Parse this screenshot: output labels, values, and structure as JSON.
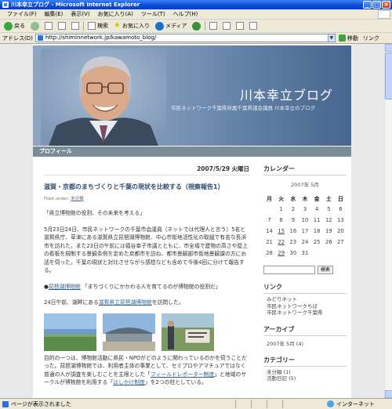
{
  "window": {
    "title": "川本幸立ブログ - Microsoft Internet Explorer"
  },
  "menu": [
    "ファイル(F)",
    "編集(E)",
    "表示(V)",
    "お気に入り(A)",
    "ツール(T)",
    "ヘルプ(H)"
  ],
  "toolbar": {
    "back": "戻る",
    "search": "検索",
    "favorites": "お気に入り",
    "media": "メディア"
  },
  "address": {
    "label": "アドレス(D)",
    "url": "http://shiminnetwork.jp/kawamoto_blog/",
    "go": "移動",
    "links": "リンク"
  },
  "blog": {
    "title": "川本幸立ブログ",
    "subtitle": "市民ネットワーク千葉県所属千葉県議会議員  川本幸立のブログ",
    "nav_profile": "プロフィール"
  },
  "post": {
    "date": "2007/5/29",
    "weekday": "火曜日",
    "title": "滋賀・京都のまちづくりと千葉の現状を比較する（視察報告1）",
    "filed_label": "Filed under:",
    "filed_category": "未分類",
    "para1": "「県立博物館の役割、その未来を考える」",
    "para2": "5月23日24日、市民ネットワークの千葉市会議員（ネットでは代理人と言う）5名と滋賀県庁、草津にある滋賀県立琵琶湖博物館、中心市街地活性化の取組で有名な長浜市を訪れた。また23日の午前には福谷幸子市議とともに、市全域で建物の高さや屋上の看板を規制する景観条例を定めた京都市を訪ね、都市景観部市街地景観課の方にお話を伺った。千葉の現状と対比させながら感想なども含めて今後4回に分けて報告する。",
    "para3_prefix": "●",
    "para3_link": "琵琶湖博物館",
    "para3_suffix": "  「まちづくりにかかわる人を育てるのが博物館の役割だ」",
    "para4_prefix": "24日午前、湖畔にある",
    "para4_link": "滋賀県立琵琶湖博物館",
    "para4_suffix": "を訪問した。",
    "para5_a": "目的の一つは、博物館活動に県民・NPOがどのように関わっているのかを伺うことだった。琵琶湖博物館では、利用者主体の事業として、セミプロやアマチュアではなく普通の人が調査を楽しむことを主眼とした「",
    "para5_link1": "フィールドレポーター制度",
    "para5_b": "」と地域のサークルが博物館を利用する「",
    "para5_link2": "はしかけ制度",
    "para5_c": "」を2つの柱としている。"
  },
  "sidebar": {
    "calendar_heading": "カレンダー",
    "month": "2007年 5月",
    "weekdays": [
      "月",
      "火",
      "水",
      "木",
      "金",
      "土",
      "日"
    ],
    "weeks": [
      [
        "",
        "1",
        "2",
        "3",
        "4",
        "5",
        "6"
      ],
      [
        "7",
        "8",
        "9",
        "10",
        "11",
        "12",
        "13"
      ],
      [
        "14",
        "15",
        "16",
        "17",
        "18",
        "19",
        "20"
      ],
      [
        "21",
        "22",
        "23",
        "24",
        "25",
        "26",
        "27"
      ],
      [
        "28",
        "29",
        "30",
        "31",
        "",
        "",
        ""
      ]
    ],
    "linked_days": [
      "15",
      "22",
      "29"
    ],
    "search_button": "検索",
    "links_heading": "リンク",
    "links": [
      "みどりネット",
      "市民ネットワークちば",
      "市民ネットワーク千葉県"
    ],
    "archive_heading": "アーカイブ",
    "archive_item": "2007年 5月 (4)",
    "category_heading": "カテゴリー",
    "categories": [
      "未分類 (1)",
      "活動日記 (5)"
    ]
  },
  "status": {
    "text": "ページが表示されました",
    "zone": "インターネット"
  },
  "colors": {
    "title_bar": "#0a4bd6",
    "banner": "#7f98b9",
    "nav": "#7b8c99",
    "link": "#2d5e8e",
    "sunday": "#d01010",
    "saturday": "#2a52be"
  }
}
